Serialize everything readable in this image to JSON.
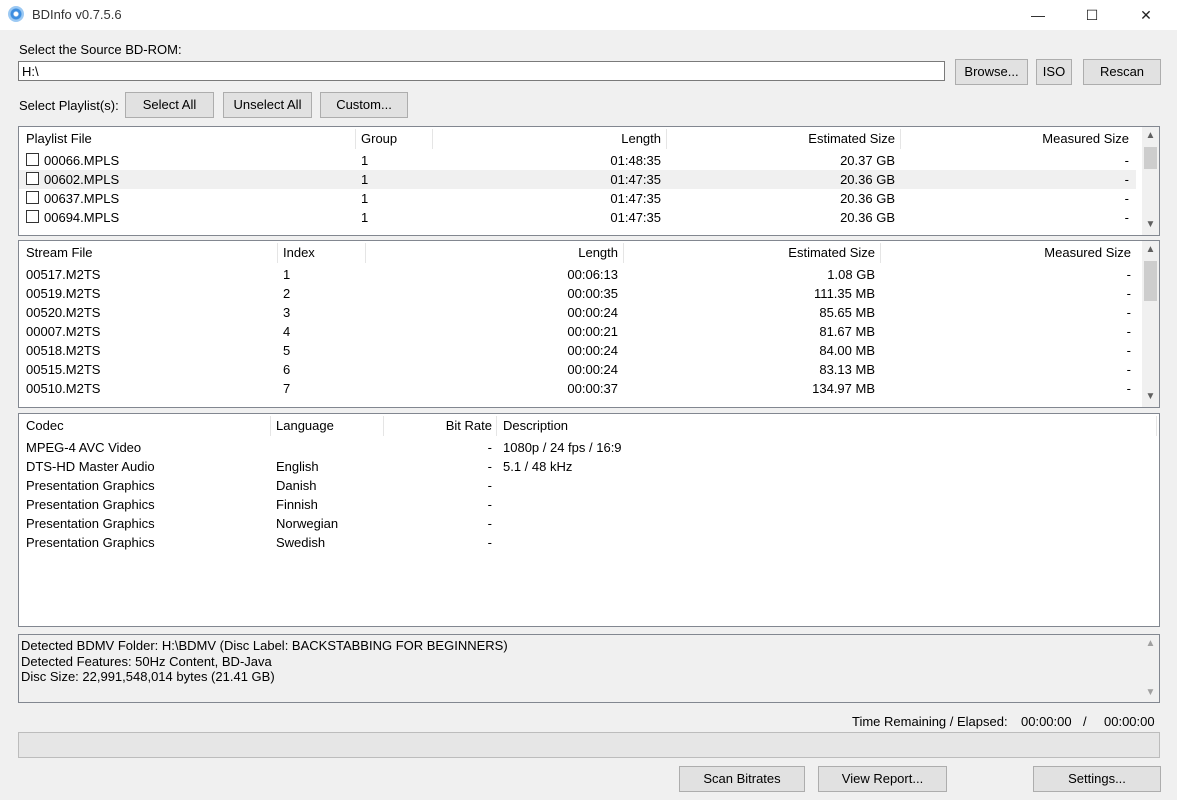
{
  "window": {
    "title": "BDInfo v0.7.5.6",
    "minimize": "—",
    "maximize": "☐",
    "close": "✕"
  },
  "source": {
    "label": "Select the Source BD-ROM:",
    "path": "H:\\",
    "browse": "Browse...",
    "iso": "ISO",
    "rescan": "Rescan"
  },
  "playlist_select": {
    "label": "Select Playlist(s):",
    "select_all": "Select All",
    "unselect_all": "Unselect All",
    "custom": "Custom..."
  },
  "playlists": {
    "headers": [
      "Playlist File",
      "Group",
      "Length",
      "Estimated Size",
      "Measured Size"
    ],
    "rows": [
      [
        "00066.MPLS",
        "1",
        "01:48:35",
        "20.37 GB",
        "-"
      ],
      [
        "00602.MPLS",
        "1",
        "01:47:35",
        "20.36 GB",
        "-"
      ],
      [
        "00637.MPLS",
        "1",
        "01:47:35",
        "20.36 GB",
        "-"
      ],
      [
        "00694.MPLS",
        "1",
        "01:47:35",
        "20.36 GB",
        "-"
      ]
    ],
    "selected_row": 1
  },
  "streams": {
    "headers": [
      "Stream File",
      "Index",
      "Length",
      "Estimated Size",
      "Measured Size"
    ],
    "rows": [
      [
        "00517.M2TS",
        "1",
        "00:06:13",
        "1.08 GB",
        "-"
      ],
      [
        "00519.M2TS",
        "2",
        "00:00:35",
        "111.35 MB",
        "-"
      ],
      [
        "00520.M2TS",
        "3",
        "00:00:24",
        "85.65 MB",
        "-"
      ],
      [
        "00007.M2TS",
        "4",
        "00:00:21",
        "81.67 MB",
        "-"
      ],
      [
        "00518.M2TS",
        "5",
        "00:00:24",
        "84.00 MB",
        "-"
      ],
      [
        "00515.M2TS",
        "6",
        "00:00:24",
        "83.13 MB",
        "-"
      ],
      [
        "00510.M2TS",
        "7",
        "00:00:37",
        "134.97 MB",
        "-"
      ]
    ]
  },
  "codecs": {
    "headers": [
      "Codec",
      "Language",
      "Bit Rate",
      "Description"
    ],
    "rows": [
      [
        "MPEG-4 AVC Video",
        "",
        "-",
        "1080p / 24 fps / 16:9"
      ],
      [
        "DTS-HD Master Audio",
        "English",
        "-",
        "5.1 / 48 kHz"
      ],
      [
        "Presentation Graphics",
        "Danish",
        "-",
        ""
      ],
      [
        "Presentation Graphics",
        "Finnish",
        "-",
        ""
      ],
      [
        "Presentation Graphics",
        "Norwegian",
        "-",
        ""
      ],
      [
        "Presentation Graphics",
        "Swedish",
        "-",
        ""
      ]
    ]
  },
  "log": [
    "Detected BDMV Folder: H:\\BDMV (Disc Label: BACKSTABBING FOR BEGINNERS)",
    "Detected Features: 50Hz Content, BD-Java",
    "Disc Size: 22,991,548,014 bytes (21.41 GB)"
  ],
  "status": {
    "time_label": "Time Remaining / Elapsed:",
    "remaining": "00:00:00",
    "separator": "/",
    "elapsed": "00:00:00",
    "progress": 0
  },
  "buttons": {
    "scan": "Scan Bitrates",
    "view_report": "View Report...",
    "settings": "Settings..."
  },
  "icons": {
    "app": "bdinfo-disc-icon",
    "scroll_up": "▲",
    "scroll_down": "▼"
  }
}
